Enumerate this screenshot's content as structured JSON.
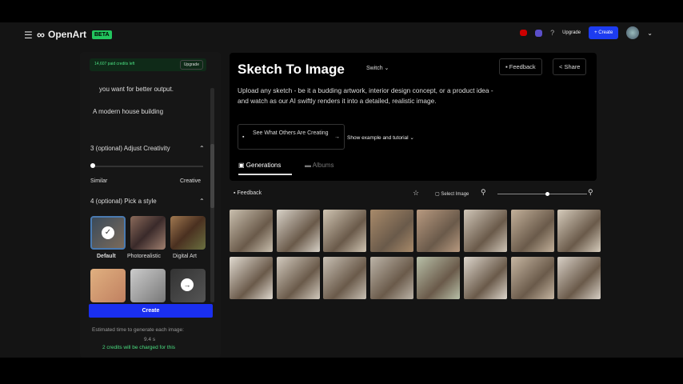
{
  "topbar": {
    "brand": "OpenArt",
    "beta": "BETA",
    "upgrade": "Upgrade",
    "create": "+ Create"
  },
  "left": {
    "credits": "14,607 paid credits left",
    "upgrade": "Upgrade",
    "hint": "you want for better output.",
    "prompt": "A modern house building",
    "step3": "3  (optional) Adjust Creativity",
    "similar": "Similar",
    "creative": "Creative",
    "step4": "4  (optional) Pick a style",
    "styles": [
      "Default",
      "Photorealistic",
      "Digital Art"
    ],
    "create": "Create",
    "estimate": "Estimated time to generate each image:",
    "time": "9.4 s",
    "charge": "2 credits will be charged for this"
  },
  "main": {
    "title": "Sketch To Image",
    "switch": "Switch ⌄",
    "feedback": "Feedback",
    "share": "Share",
    "description": "Upload any sketch - be it a budding artwork, interior design concept, or a product idea - and watch as our AI swiftly renders it into a detailed, realistic image.",
    "see_others": "See What Others Are Creating",
    "tutorial": "Show example and tutorial ⌄",
    "tabs": [
      "Generations",
      "Albums"
    ]
  },
  "toolbar": {
    "feedback": "Feedback",
    "select": "Select Image",
    "zoom_level": 0.55
  }
}
